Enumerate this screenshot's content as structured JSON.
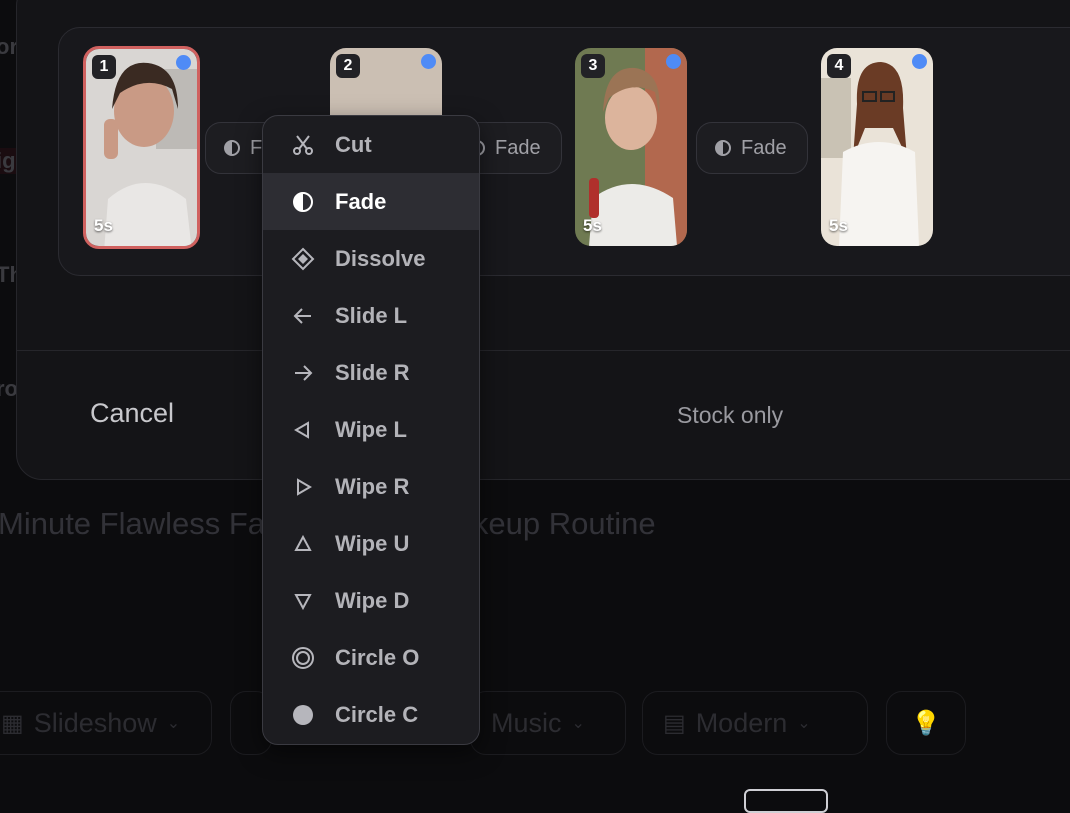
{
  "background": {
    "left_fragments": [
      "or",
      "ig",
      "Th",
      "ro"
    ],
    "title": "Minute Flawless Fa                         e Workday Makeup Routine",
    "toolbar": [
      {
        "label": "Slideshow",
        "icon": "slides-icon"
      },
      {
        "label": "",
        "icon": "clock-icon"
      },
      {
        "label": "Music",
        "icon": "music-icon"
      },
      {
        "label": "Modern",
        "icon": "caption-icon"
      },
      {
        "label": "",
        "icon": "lightbulb-icon"
      }
    ]
  },
  "modal": {
    "cancel_label": "Cancel",
    "stock_label": "Stock only"
  },
  "clips": [
    {
      "number": "1",
      "duration": "5s",
      "selected": true
    },
    {
      "number": "2",
      "duration": "",
      "selected": false
    },
    {
      "number": "3",
      "duration": "5s",
      "selected": false
    },
    {
      "number": "4",
      "duration": "5s",
      "selected": false
    }
  ],
  "transitions": [
    {
      "label": "F"
    },
    {
      "label": "Fade"
    },
    {
      "label": "Fade"
    }
  ],
  "menu": {
    "selected": "Fade",
    "items": [
      {
        "label": "Cut",
        "icon": "scissors-icon"
      },
      {
        "label": "Fade",
        "icon": "half-circle-icon"
      },
      {
        "label": "Dissolve",
        "icon": "diamond-icon"
      },
      {
        "label": "Slide L",
        "icon": "arrow-left-icon"
      },
      {
        "label": "Slide R",
        "icon": "arrow-right-icon"
      },
      {
        "label": "Wipe L",
        "icon": "triangle-left-icon"
      },
      {
        "label": "Wipe R",
        "icon": "triangle-right-icon"
      },
      {
        "label": "Wipe U",
        "icon": "triangle-up-icon"
      },
      {
        "label": "Wipe D",
        "icon": "triangle-down-icon"
      },
      {
        "label": "Circle O",
        "icon": "circle-open-icon"
      },
      {
        "label": "Circle C",
        "icon": "circle-close-icon"
      }
    ]
  },
  "colors": {
    "accent_dot": "#4f8bf6",
    "selected_border": "#d0615f"
  }
}
